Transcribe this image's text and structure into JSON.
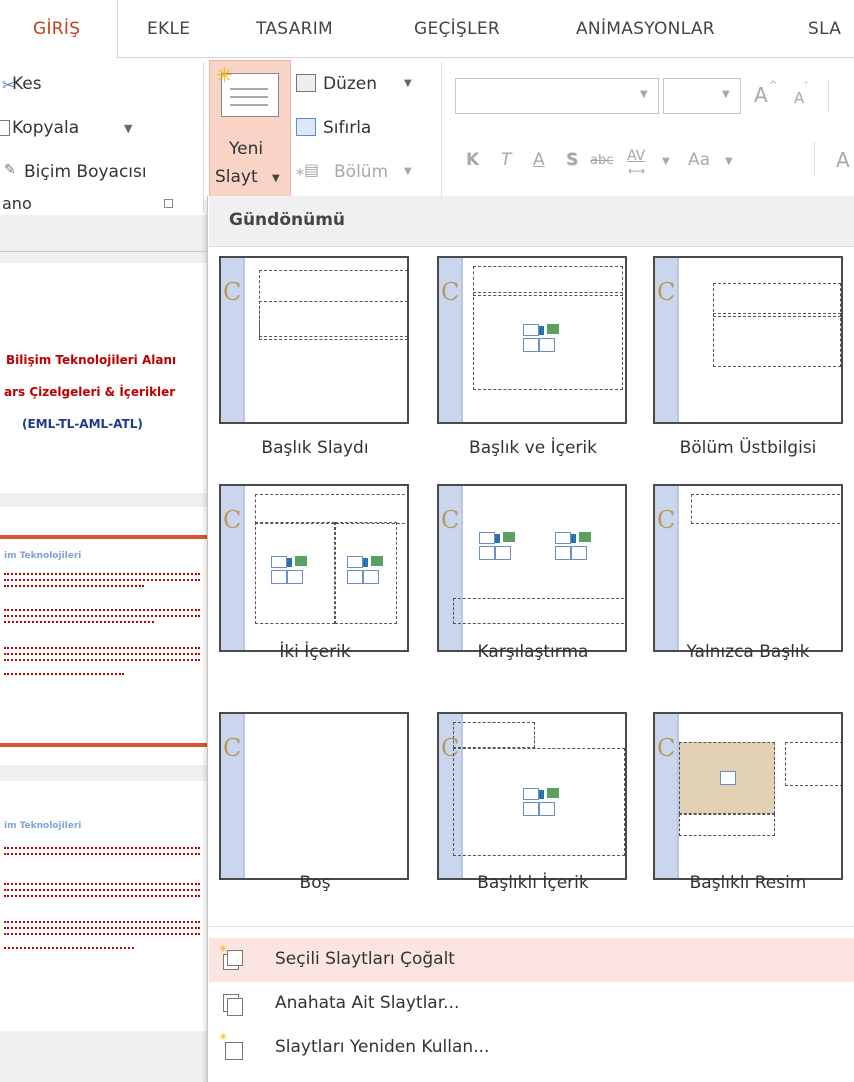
{
  "ribbon": {
    "tabs": [
      {
        "label": "GİRİŞ",
        "active": true
      },
      {
        "label": "EKLE"
      },
      {
        "label": "TASARIM"
      },
      {
        "label": "GEÇİŞLER"
      },
      {
        "label": "ANİMASYONLAR"
      },
      {
        "label": "SLA"
      }
    ],
    "clipboard": {
      "cut": "Kes",
      "copy": "Kopyala",
      "format_painter": "Biçim Boyacısı",
      "group_label": "ano"
    },
    "slides": {
      "new_slide_line1": "Yeni",
      "new_slide_line2": "Slayt",
      "layout": "Düzen",
      "reset": "Sıfırla",
      "section": "Bölüm"
    },
    "font": {
      "bold": "K",
      "italic": "T",
      "underline": "A",
      "shadow": "S",
      "strike": "abc",
      "spacing": "AV",
      "case": "Aa",
      "grow": "A",
      "shrink": "A",
      "clear": "A"
    }
  },
  "slide_pane": {
    "slide1": {
      "line1": "Bilişim Teknolojileri Alanı",
      "line2": "ars Çizelgeleri & İçerikler",
      "line3": "(EML-TL-AML-ATL)"
    },
    "slide2_title": "im Teknolojileri",
    "slide3_title": "im Teknolojileri"
  },
  "gallery": {
    "header": "Gündönümü",
    "layouts": [
      {
        "label": "Başlık Slaydı"
      },
      {
        "label": "Başlık ve İçerik"
      },
      {
        "label": "Bölüm Üstbilgisi"
      },
      {
        "label": "İki İçerik"
      },
      {
        "label": "Karşılaştırma"
      },
      {
        "label": "Yalnızca Başlık"
      },
      {
        "label": "Boş"
      },
      {
        "label": "Başlıklı İçerik"
      },
      {
        "label": "Başlıklı Resim"
      }
    ],
    "menu": [
      {
        "label": "Seçili Slaytları Çoğalt"
      },
      {
        "label": "Anahata Ait Slaytlar..."
      },
      {
        "label": "Slaytları Yeniden Kullan..."
      }
    ]
  },
  "colors": {
    "accent": "#c43e1c",
    "highlight": "#fce4e0",
    "new_slide_bg": "#f9d3c6",
    "slide_red": "#c00000"
  }
}
